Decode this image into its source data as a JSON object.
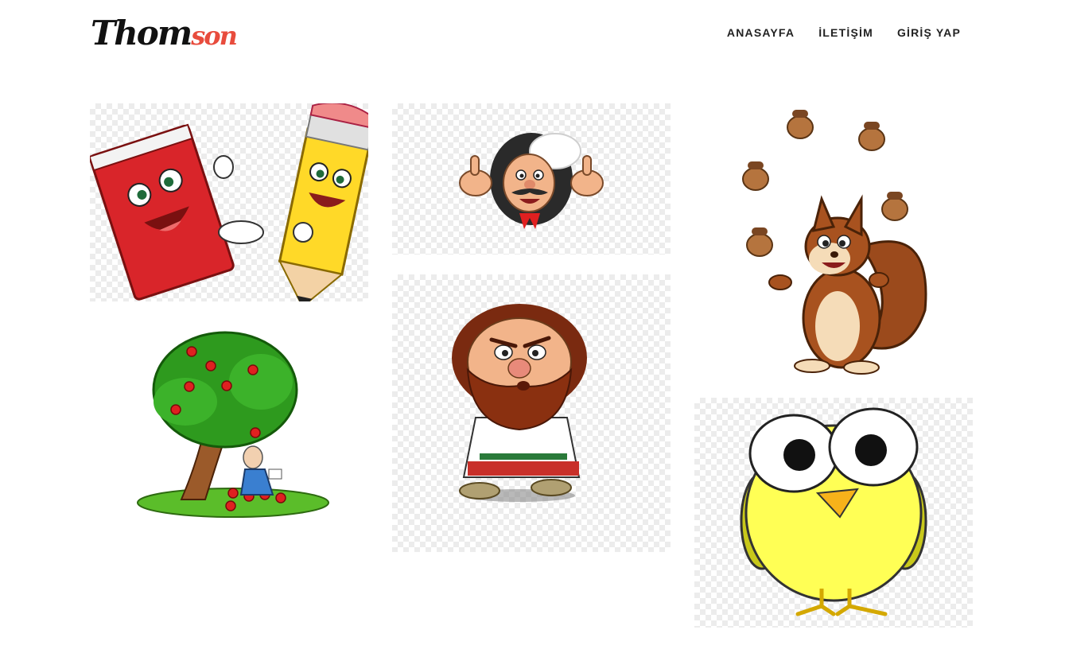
{
  "header": {
    "logo": {
      "main": "Thom",
      "accent": "son"
    },
    "nav": [
      {
        "label": "ANASAYFA"
      },
      {
        "label": "İLETİŞİM"
      },
      {
        "label": "GİRİŞ YAP"
      }
    ]
  },
  "gallery": {
    "items": [
      {
        "subject": "book-and-pencil-handshake"
      },
      {
        "subject": "chef-thumbs-up"
      },
      {
        "subject": "squirrel-juggling-acorns"
      },
      {
        "subject": "newton-under-apple-tree"
      },
      {
        "subject": "bearded-peasant"
      },
      {
        "subject": "yellow-bird-big-eyes"
      }
    ]
  },
  "colors": {
    "accent": "#e84c3d",
    "text": "#222222",
    "background": "#ffffff"
  }
}
